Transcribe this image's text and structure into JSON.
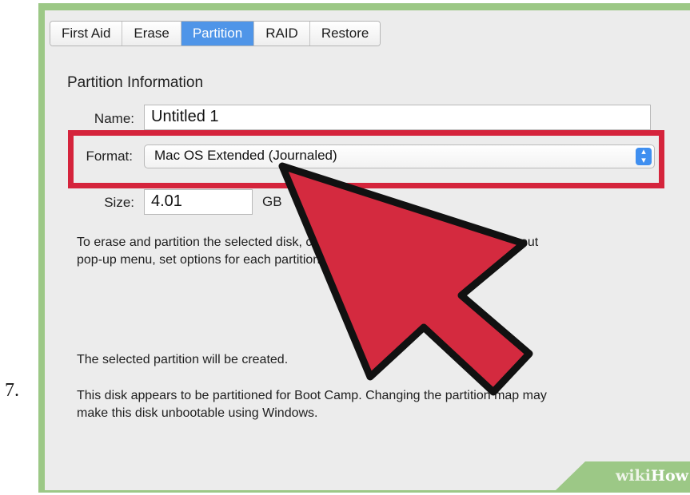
{
  "step": {
    "number": "7."
  },
  "tabs": [
    {
      "label": "First Aid"
    },
    {
      "label": "Erase"
    },
    {
      "label": "Partition"
    },
    {
      "label": "RAID"
    },
    {
      "label": "Restore"
    }
  ],
  "partition_info": {
    "title": "Partition Information",
    "name_label": "Name:",
    "name_value": "Untitled 1",
    "format_label": "Format:",
    "format_value": "Mac OS Extended (Journaled)",
    "size_label": "Size:",
    "size_value": "4.01",
    "size_unit": "GB"
  },
  "messages": {
    "instructions_line1": "To erase and partition the selected disk, choose a layout from the Partition Layout",
    "instructions_line2": "pop-up menu, set options for each partition, and click Apply.",
    "created": "The selected partition will be created.",
    "bootcamp_line1": "This disk appears to be partitioned for Boot Camp. Changing the partition map may",
    "bootcamp_line2": "make this disk unbootable using Windows."
  },
  "watermark": {
    "wiki": "wiki",
    "how": "How"
  },
  "colors": {
    "highlight": "#d5243c",
    "arrow": "#d42a3f",
    "active_tab": "#4f95e8",
    "frame": "#9cc886"
  }
}
